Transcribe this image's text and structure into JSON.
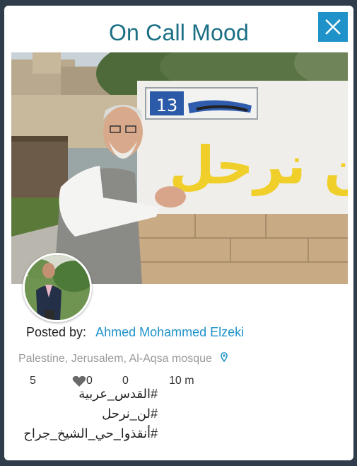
{
  "dialog": {
    "title": "On Call Mood",
    "close_icon": "close-icon"
  },
  "post": {
    "image_description_icon": "photo",
    "street_sign_number": "13",
    "graffiti_text": "لن نرحل",
    "posted_by_label": "Posted by:",
    "author": "Ahmed Mohammed Elzeki",
    "location": "Palestine, Jerusalem, Al-Aqsa mosque",
    "location_icon": "location-pin-icon",
    "stats": {
      "count_1": "5",
      "likes": "0",
      "like_icon": "heart-icon",
      "count_3": "0",
      "time_ago": "10 m"
    },
    "hashtags": [
      "#القدس_عربية",
      "#لن_نرحل",
      "#أنقذوا_حي_الشيخ_جراح"
    ]
  },
  "colors": {
    "title": "#1a6f85",
    "accent": "#1e92c9",
    "background_frame": "#2f3d4a",
    "location_text": "#9a9a9a"
  }
}
